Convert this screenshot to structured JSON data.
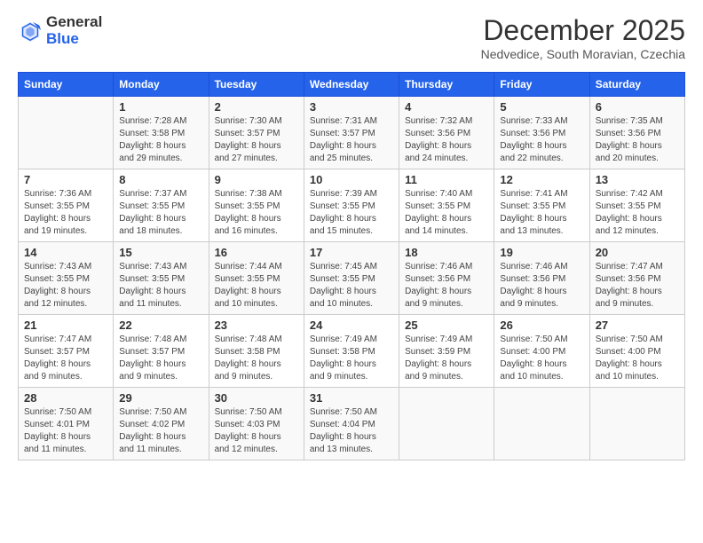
{
  "logo": {
    "general": "General",
    "blue": "Blue"
  },
  "title": "December 2025",
  "subtitle": "Nedvedice, South Moravian, Czechia",
  "days_of_week": [
    "Sunday",
    "Monday",
    "Tuesday",
    "Wednesday",
    "Thursday",
    "Friday",
    "Saturday"
  ],
  "weeks": [
    [
      {
        "num": "",
        "sunrise": "",
        "sunset": "",
        "daylight": ""
      },
      {
        "num": "1",
        "sunrise": "Sunrise: 7:28 AM",
        "sunset": "Sunset: 3:58 PM",
        "daylight": "Daylight: 8 hours and 29 minutes."
      },
      {
        "num": "2",
        "sunrise": "Sunrise: 7:30 AM",
        "sunset": "Sunset: 3:57 PM",
        "daylight": "Daylight: 8 hours and 27 minutes."
      },
      {
        "num": "3",
        "sunrise": "Sunrise: 7:31 AM",
        "sunset": "Sunset: 3:57 PM",
        "daylight": "Daylight: 8 hours and 25 minutes."
      },
      {
        "num": "4",
        "sunrise": "Sunrise: 7:32 AM",
        "sunset": "Sunset: 3:56 PM",
        "daylight": "Daylight: 8 hours and 24 minutes."
      },
      {
        "num": "5",
        "sunrise": "Sunrise: 7:33 AM",
        "sunset": "Sunset: 3:56 PM",
        "daylight": "Daylight: 8 hours and 22 minutes."
      },
      {
        "num": "6",
        "sunrise": "Sunrise: 7:35 AM",
        "sunset": "Sunset: 3:56 PM",
        "daylight": "Daylight: 8 hours and 20 minutes."
      }
    ],
    [
      {
        "num": "7",
        "sunrise": "Sunrise: 7:36 AM",
        "sunset": "Sunset: 3:55 PM",
        "daylight": "Daylight: 8 hours and 19 minutes."
      },
      {
        "num": "8",
        "sunrise": "Sunrise: 7:37 AM",
        "sunset": "Sunset: 3:55 PM",
        "daylight": "Daylight: 8 hours and 18 minutes."
      },
      {
        "num": "9",
        "sunrise": "Sunrise: 7:38 AM",
        "sunset": "Sunset: 3:55 PM",
        "daylight": "Daylight: 8 hours and 16 minutes."
      },
      {
        "num": "10",
        "sunrise": "Sunrise: 7:39 AM",
        "sunset": "Sunset: 3:55 PM",
        "daylight": "Daylight: 8 hours and 15 minutes."
      },
      {
        "num": "11",
        "sunrise": "Sunrise: 7:40 AM",
        "sunset": "Sunset: 3:55 PM",
        "daylight": "Daylight: 8 hours and 14 minutes."
      },
      {
        "num": "12",
        "sunrise": "Sunrise: 7:41 AM",
        "sunset": "Sunset: 3:55 PM",
        "daylight": "Daylight: 8 hours and 13 minutes."
      },
      {
        "num": "13",
        "sunrise": "Sunrise: 7:42 AM",
        "sunset": "Sunset: 3:55 PM",
        "daylight": "Daylight: 8 hours and 12 minutes."
      }
    ],
    [
      {
        "num": "14",
        "sunrise": "Sunrise: 7:43 AM",
        "sunset": "Sunset: 3:55 PM",
        "daylight": "Daylight: 8 hours and 12 minutes."
      },
      {
        "num": "15",
        "sunrise": "Sunrise: 7:43 AM",
        "sunset": "Sunset: 3:55 PM",
        "daylight": "Daylight: 8 hours and 11 minutes."
      },
      {
        "num": "16",
        "sunrise": "Sunrise: 7:44 AM",
        "sunset": "Sunset: 3:55 PM",
        "daylight": "Daylight: 8 hours and 10 minutes."
      },
      {
        "num": "17",
        "sunrise": "Sunrise: 7:45 AM",
        "sunset": "Sunset: 3:55 PM",
        "daylight": "Daylight: 8 hours and 10 minutes."
      },
      {
        "num": "18",
        "sunrise": "Sunrise: 7:46 AM",
        "sunset": "Sunset: 3:56 PM",
        "daylight": "Daylight: 8 hours and 9 minutes."
      },
      {
        "num": "19",
        "sunrise": "Sunrise: 7:46 AM",
        "sunset": "Sunset: 3:56 PM",
        "daylight": "Daylight: 8 hours and 9 minutes."
      },
      {
        "num": "20",
        "sunrise": "Sunrise: 7:47 AM",
        "sunset": "Sunset: 3:56 PM",
        "daylight": "Daylight: 8 hours and 9 minutes."
      }
    ],
    [
      {
        "num": "21",
        "sunrise": "Sunrise: 7:47 AM",
        "sunset": "Sunset: 3:57 PM",
        "daylight": "Daylight: 8 hours and 9 minutes."
      },
      {
        "num": "22",
        "sunrise": "Sunrise: 7:48 AM",
        "sunset": "Sunset: 3:57 PM",
        "daylight": "Daylight: 8 hours and 9 minutes."
      },
      {
        "num": "23",
        "sunrise": "Sunrise: 7:48 AM",
        "sunset": "Sunset: 3:58 PM",
        "daylight": "Daylight: 8 hours and 9 minutes."
      },
      {
        "num": "24",
        "sunrise": "Sunrise: 7:49 AM",
        "sunset": "Sunset: 3:58 PM",
        "daylight": "Daylight: 8 hours and 9 minutes."
      },
      {
        "num": "25",
        "sunrise": "Sunrise: 7:49 AM",
        "sunset": "Sunset: 3:59 PM",
        "daylight": "Daylight: 8 hours and 9 minutes."
      },
      {
        "num": "26",
        "sunrise": "Sunrise: 7:50 AM",
        "sunset": "Sunset: 4:00 PM",
        "daylight": "Daylight: 8 hours and 10 minutes."
      },
      {
        "num": "27",
        "sunrise": "Sunrise: 7:50 AM",
        "sunset": "Sunset: 4:00 PM",
        "daylight": "Daylight: 8 hours and 10 minutes."
      }
    ],
    [
      {
        "num": "28",
        "sunrise": "Sunrise: 7:50 AM",
        "sunset": "Sunset: 4:01 PM",
        "daylight": "Daylight: 8 hours and 11 minutes."
      },
      {
        "num": "29",
        "sunrise": "Sunrise: 7:50 AM",
        "sunset": "Sunset: 4:02 PM",
        "daylight": "Daylight: 8 hours and 11 minutes."
      },
      {
        "num": "30",
        "sunrise": "Sunrise: 7:50 AM",
        "sunset": "Sunset: 4:03 PM",
        "daylight": "Daylight: 8 hours and 12 minutes."
      },
      {
        "num": "31",
        "sunrise": "Sunrise: 7:50 AM",
        "sunset": "Sunset: 4:04 PM",
        "daylight": "Daylight: 8 hours and 13 minutes."
      },
      {
        "num": "",
        "sunrise": "",
        "sunset": "",
        "daylight": ""
      },
      {
        "num": "",
        "sunrise": "",
        "sunset": "",
        "daylight": ""
      },
      {
        "num": "",
        "sunrise": "",
        "sunset": "",
        "daylight": ""
      }
    ]
  ]
}
